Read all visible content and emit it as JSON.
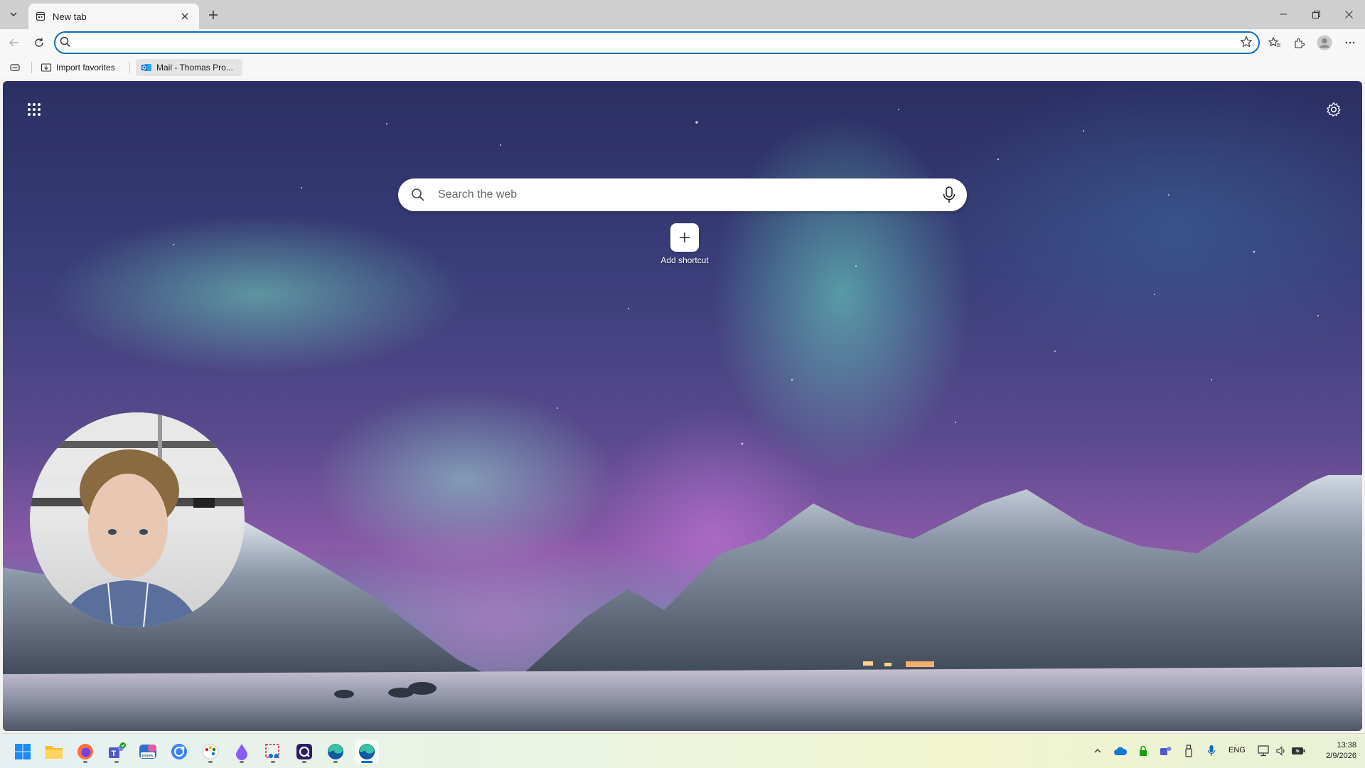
{
  "window": {
    "tab_title": "New tab",
    "controls": [
      "minimize",
      "restore",
      "close"
    ]
  },
  "toolbar": {
    "address_value": "",
    "address_placeholder": ""
  },
  "favorites_bar": {
    "items": [
      {
        "label": "Import favorites",
        "icon": "import-favorites-icon"
      },
      {
        "label": "Mail - Thomas Pro...",
        "icon": "outlook-icon"
      }
    ]
  },
  "new_tab_page": {
    "search_placeholder": "Search the web",
    "shortcut_label": "Add shortcut"
  },
  "taskbar": {
    "apps": [
      "start",
      "file-explorer",
      "firefox",
      "teams",
      "microsoft-365",
      "copilot",
      "paint",
      "app-purple",
      "snipping-tool",
      "clipchamp",
      "edge",
      "edge-active"
    ],
    "language": "ENG",
    "time": "13:38",
    "date": "2/9/2026"
  },
  "colors": {
    "accent": "#0f6cbd",
    "tab_strip": "#cfcfcf",
    "toolbar": "#f7f7f7"
  }
}
